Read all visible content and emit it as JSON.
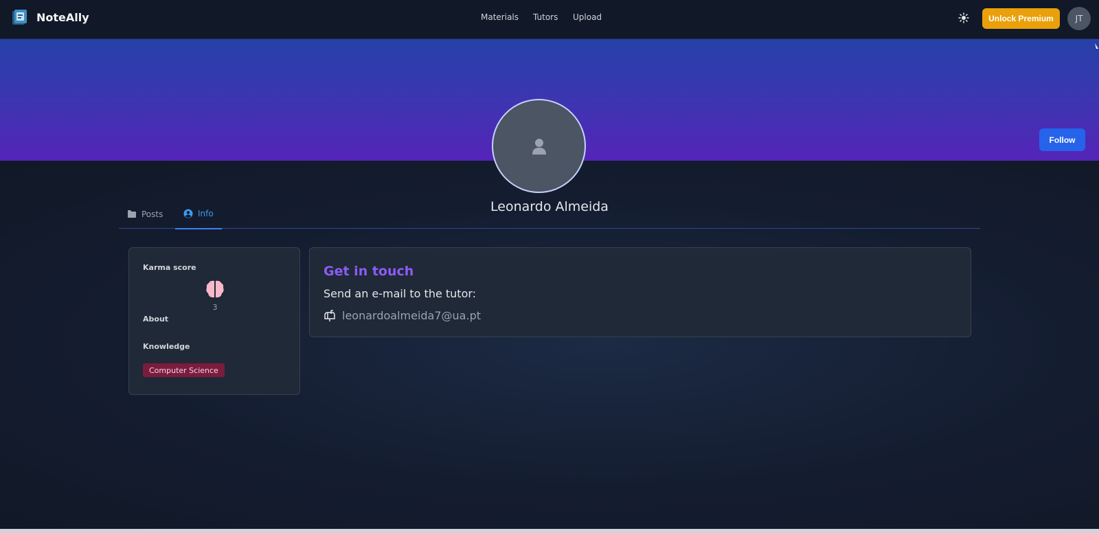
{
  "navbar": {
    "brand": "NoteAlly",
    "links": [
      "Materials",
      "Tutors",
      "Upload"
    ],
    "premium_label": "Unlock Premium",
    "user_initials": "JT"
  },
  "profile": {
    "name": "Leonardo Almeida",
    "follow_label": "Follow"
  },
  "tabs": [
    {
      "label": "Posts",
      "icon": "folder-icon",
      "active": false
    },
    {
      "label": "Info",
      "icon": "user-circle-icon",
      "active": true
    }
  ],
  "info_card": {
    "karma_label": "Karma score",
    "karma_icon": "brain-icon",
    "karma_value": "3",
    "about_label": "About",
    "knowledge_label": "Knowledge",
    "knowledge_tags": [
      "Computer Science"
    ]
  },
  "contact_card": {
    "title": "Get in touch",
    "subtitle": "Send an e-mail to the tutor:",
    "email_icon": "mailbox-icon",
    "email": "leonardoalmeida7@ua.pt"
  },
  "colors": {
    "accent": "#2563eb",
    "premium": "#eaa00b",
    "title_purple": "#8b5cf6",
    "tab_active": "#3b9bf0",
    "badge_bg": "#7a1d3d"
  }
}
